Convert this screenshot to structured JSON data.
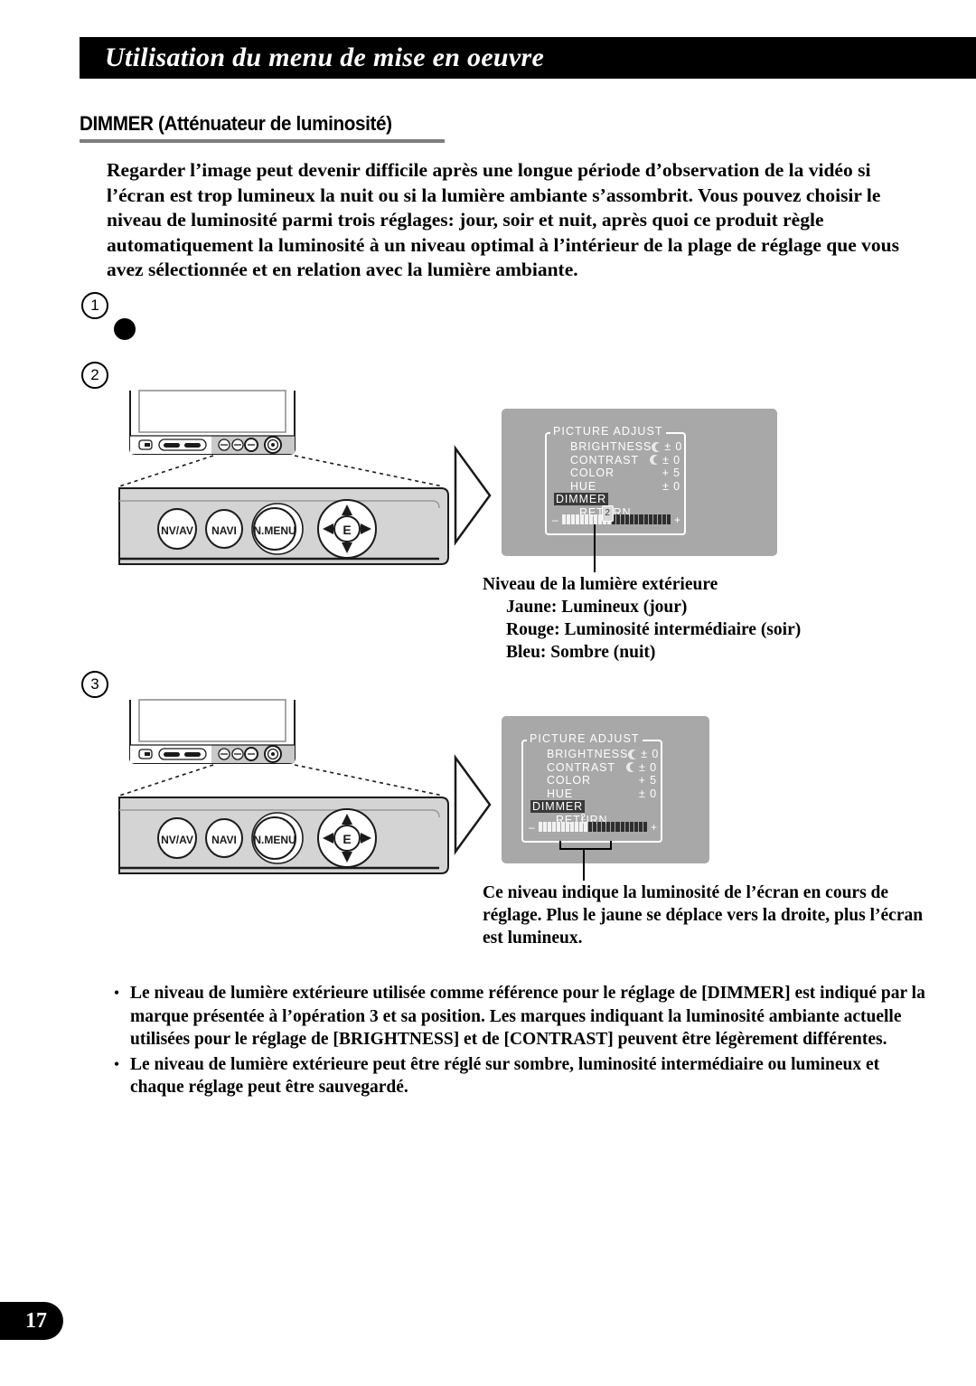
{
  "header": {
    "title": "Utilisation du menu de mise en oeuvre"
  },
  "section": {
    "heading": "DIMMER (Atténuateur de luminosité)"
  },
  "intro": {
    "paragraph": "Regarder l’image peut devenir difficile après une longue période d’observation de la vidéo si l’écran est trop lumineux la nuit ou si la lumière ambiante s’assombrit. Vous pouvez choisir le niveau de luminosité parmi trois réglages: jour, soir et nuit, après quoi ce produit règle automatiquement la luminosité à un niveau optimal à l’intérieur de la plage de réglage que vous avez sélectionnée et en relation avec la lumière ambiante."
  },
  "steps": {
    "one": "1",
    "two": "2",
    "three": "3"
  },
  "device": {
    "buttons": {
      "nv_av": "NV/AV",
      "navi": "NAVI",
      "n_menu": "N.MENU",
      "enter": "E"
    }
  },
  "osd": {
    "title": "PICTURE  ADJUST",
    "rows": [
      {
        "label": "BRIGHTNESS",
        "value": "± 0",
        "icon": "moon-icon",
        "highlight": false
      },
      {
        "label": "CONTRAST",
        "value": "± 0",
        "icon": "moon-icon",
        "highlight": false
      },
      {
        "label": "COLOR",
        "value": "+ 5",
        "icon": "",
        "highlight": false
      },
      {
        "label": "HUE",
        "value": "± 0",
        "icon": "",
        "highlight": false
      },
      {
        "label": "DIMMER",
        "value": "",
        "icon": "",
        "highlight": true
      },
      {
        "label": "RETURN",
        "value": "",
        "icon": "",
        "highlight": false
      }
    ],
    "slider": {
      "minus": "–",
      "plus": "+",
      "marker_label": "2",
      "segments_light": 11,
      "segments_dark": 13
    }
  },
  "captions": {
    "exterior_light": {
      "title": "Niveau de la lumière extérieure",
      "line_yellow": "Jaune: Lumineux (jour)",
      "line_red": "Rouge: Luminosité intermédiaire (soir)",
      "line_blue": "Bleu: Sombre (nuit)"
    },
    "level_note": "Ce niveau indique la luminosité de l’écran en cours de réglage. Plus le jaune se déplace vers la droite, plus l’écran est lumineux."
  },
  "bullets": {
    "marker": "•",
    "items": [
      "Le niveau de lumière extérieure utilisée comme référence pour le réglage de [DIMMER] est indiqué par la marque présentée à l’opération 3 et sa position. Les marques indiquant la luminosité ambiante actuelle utilisées pour le réglage de [BRIGHTNESS] et de [CONTRAST] peuvent être légèrement différentes.",
      "Le niveau de lumière extérieure peut être réglé sur sombre, luminosité intermédiaire ou lumineux et chaque réglage peut être sauvegardé."
    ]
  },
  "footer": {
    "page_number": "17"
  },
  "colors": {
    "header_bg": "#000000",
    "rule_gray": "#7d7d7d",
    "osd_bg": "#a8a8a8",
    "osd_text": "#ffffff",
    "highlight_bg": "#3a3a3a",
    "slider_light": "#f2f2f2",
    "slider_dark": "#2e2e2e"
  }
}
